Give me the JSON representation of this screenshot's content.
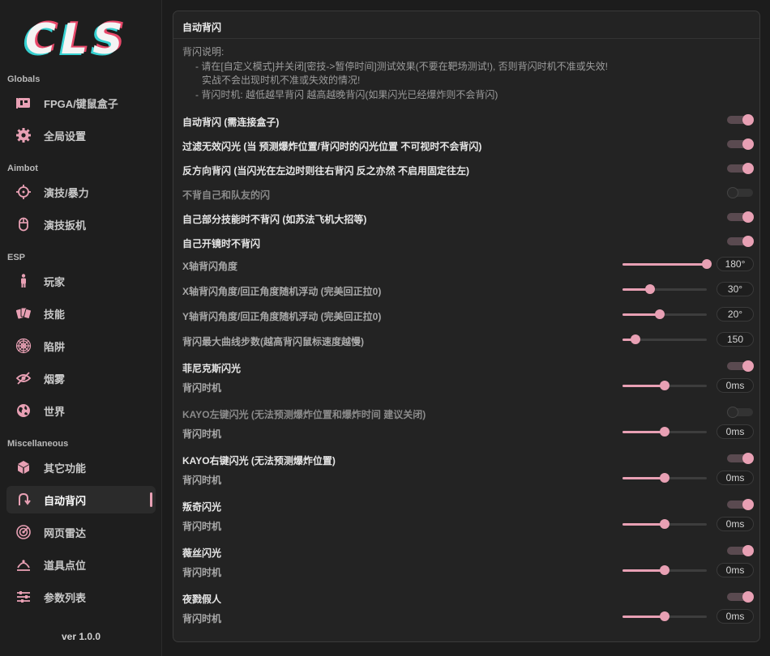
{
  "app": {
    "logo_text": "CLS",
    "version": "ver 1.0.0",
    "accent": "#e8a0b4"
  },
  "sidebar": {
    "sections": [
      {
        "title": "Globals"
      },
      {
        "title": "Aimbot"
      },
      {
        "title": "ESP"
      },
      {
        "title": "Miscellaneous"
      }
    ],
    "items": [
      {
        "label": "FPGA/键鼠盒子",
        "icon": "fpga-card-icon"
      },
      {
        "label": "全局设置",
        "icon": "gear-icon"
      },
      {
        "label": "演技/暴力",
        "icon": "crosshair-icon"
      },
      {
        "label": "演技扳机",
        "icon": "mouse-icon"
      },
      {
        "label": "玩家",
        "icon": "person-icon"
      },
      {
        "label": "技能",
        "icon": "cards-icon"
      },
      {
        "label": "陷阱",
        "icon": "spider-web-icon"
      },
      {
        "label": "烟雾",
        "icon": "eye-slash-icon"
      },
      {
        "label": "世界",
        "icon": "globe-icon"
      },
      {
        "label": "其它功能",
        "icon": "cube-icon"
      },
      {
        "label": "自动背闪",
        "icon": "u-turn-icon"
      },
      {
        "label": "网页雷达",
        "icon": "radar-icon"
      },
      {
        "label": "道具点位",
        "icon": "location-icon"
      },
      {
        "label": "参数列表",
        "icon": "sliders-icon"
      }
    ],
    "active_item": "自动背闪"
  },
  "panel": {
    "title": "自动背闪",
    "description": [
      "背闪说明:",
      "- 请在[自定义模式]并关闭[密技->暂停时间]测试效果(不要在靶场测试!), 否则背闪时机不准或失效!",
      "实战不会出现时机不准或失效的情况!",
      "- 背闪时机: 越低越早背闪 越高越晚背闪(如果闪光已经爆炸则不会背闪)"
    ],
    "toggles": [
      {
        "label": "自动背闪 (需连接盒子)",
        "on": true
      },
      {
        "label": "过滤无效闪光 (当 预测爆炸位置/背闪时的闪光位置 不可视时不会背闪)",
        "on": true
      },
      {
        "label": "反方向背闪 (当闪光在左边时则往右背闪 反之亦然  不启用固定往左)",
        "on": true
      },
      {
        "label": "不背自己和队友的闪",
        "on": false
      },
      {
        "label": "自己部分技能时不背闪 (如苏法飞机大招等)",
        "on": true
      },
      {
        "label": "自己开镜时不背闪",
        "on": true
      }
    ],
    "sliders": [
      {
        "label": "X轴背闪角度",
        "value": "180°",
        "fraction": 1.0
      },
      {
        "label": "X轴背闪角度/回正角度随机浮动 (完美回正拉0)",
        "value": "30°",
        "fraction": 0.33
      },
      {
        "label": "Y轴背闪角度/回正角度随机浮动 (完美回正拉0)",
        "value": "20°",
        "fraction": 0.44
      },
      {
        "label": "背闪最大曲线步数(越高背闪鼠标速度越慢)",
        "value": "150",
        "fraction": 0.15
      }
    ],
    "agents": [
      {
        "label": "菲尼克斯闪光",
        "on": true,
        "sub_label": "背闪时机",
        "value": "0ms",
        "fraction": 0.5
      },
      {
        "label": "KAYO左键闪光 (无法预测爆炸位置和爆炸时间 建议关闭)",
        "on": false,
        "sub_label": "背闪时机",
        "value": "0ms",
        "fraction": 0.5
      },
      {
        "label": "KAYO右键闪光 (无法预测爆炸位置)",
        "on": true,
        "sub_label": "背闪时机",
        "value": "0ms",
        "fraction": 0.5
      },
      {
        "label": "叛奇闪光",
        "on": true,
        "sub_label": "背闪时机",
        "value": "0ms",
        "fraction": 0.5
      },
      {
        "label": "薇丝闪光",
        "on": true,
        "sub_label": "背闪时机",
        "value": "0ms",
        "fraction": 0.5
      },
      {
        "label": "夜戮假人",
        "on": true,
        "sub_label": "背闪时机",
        "value": "0ms",
        "fraction": 0.5
      }
    ]
  }
}
